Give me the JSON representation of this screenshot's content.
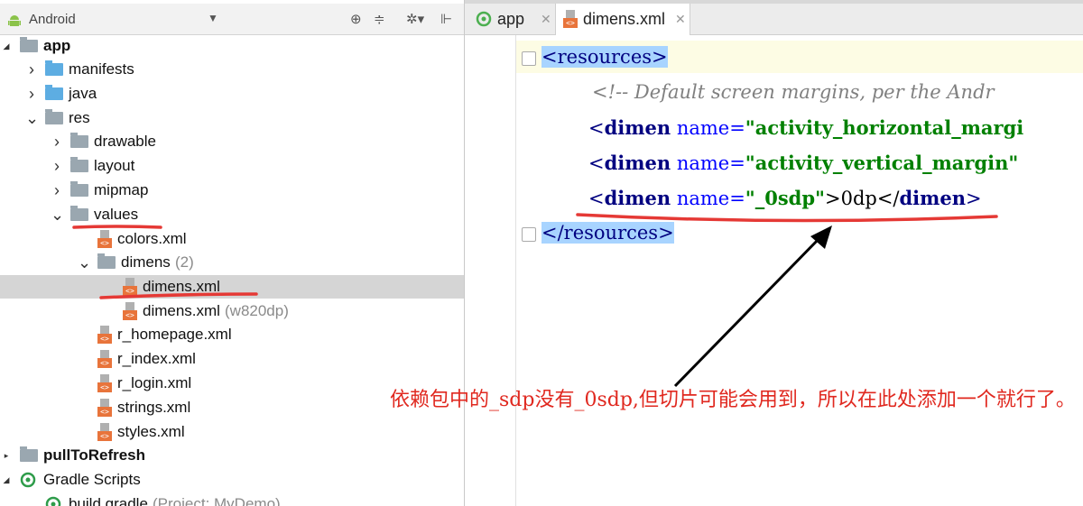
{
  "project_panel": {
    "view_label": "Android",
    "dropdown_icon": "triangle-down",
    "tools": [
      "crosshair-icon",
      "collapse-icon",
      "gear-icon",
      "pin-icon"
    ]
  },
  "tree": [
    {
      "label": "app",
      "bold": true,
      "icon": "module-folder",
      "expanded": true
    },
    {
      "label": "manifests",
      "icon": "folder-blue",
      "expanded": false
    },
    {
      "label": "java",
      "icon": "folder-blue",
      "expanded": false
    },
    {
      "label": "res",
      "icon": "res-folder",
      "expanded": true
    },
    {
      "label": "drawable",
      "icon": "folder-gray",
      "expanded": false
    },
    {
      "label": "layout",
      "icon": "folder-gray",
      "expanded": false
    },
    {
      "label": "mipmap",
      "icon": "folder-gray",
      "expanded": false
    },
    {
      "label": "values",
      "icon": "folder-gray",
      "expanded": true
    },
    {
      "label": "colors.xml",
      "icon": "xml-file"
    },
    {
      "label": "dimens",
      "qualifier": "(2)",
      "icon": "folder-gray",
      "expanded": true
    },
    {
      "label": "dimens.xml",
      "icon": "xml-file",
      "selected": true
    },
    {
      "label": "dimens.xml",
      "qualifier": "(w820dp)",
      "icon": "xml-file"
    },
    {
      "label": "r_homepage.xml",
      "icon": "xml-file"
    },
    {
      "label": "r_index.xml",
      "icon": "xml-file"
    },
    {
      "label": "r_login.xml",
      "icon": "xml-file"
    },
    {
      "label": "strings.xml",
      "icon": "xml-file"
    },
    {
      "label": "styles.xml",
      "icon": "xml-file"
    },
    {
      "label": "pullToRefresh",
      "bold": true,
      "icon": "module-folder",
      "expanded": false
    },
    {
      "label": "Gradle Scripts",
      "icon": "gradle-icon",
      "expanded": true
    },
    {
      "label": "build.gradle",
      "qualifier": "(Project: MyDemo)",
      "icon": "gradle-icon"
    }
  ],
  "editor": {
    "tabs": [
      {
        "label": "app",
        "icon": "app-module-icon"
      },
      {
        "label": "dimens.xml",
        "icon": "xml-file-icon",
        "active": true
      }
    ],
    "lines": {
      "l1_open": "<",
      "l1_name": "resources",
      "l1_close": ">",
      "l2_comment": "<!-- Default screen margins, per the Andr",
      "l3_open": "<",
      "l3_name": "dimen",
      "l3_attr": "name=",
      "l3_val": "\"activity_horizontal_margi",
      "l4_open": "<",
      "l4_name": "dimen",
      "l4_attr": "name=",
      "l4_val": "\"activity_vertical_margin\"",
      "l5_open": "<",
      "l5_name": "dimen",
      "l5_attr": "name=",
      "l5_val": "\"_0sdp\"",
      "l5_text": ">0dp</",
      "l5_name2": "dimen",
      "l5_end": ">",
      "l6_open": "</",
      "l6_name": "resources",
      "l6_close": ">"
    }
  },
  "annotation": {
    "text": "依赖包中的_sdp没有_0sdp,但切片可能会用到，所以在此处添加一个就行了。",
    "color": "#e0281f"
  },
  "colors": {
    "selection": "#d5d5d5",
    "tag": "#000080",
    "attr": "#0000ff",
    "value": "#008000",
    "comment": "#808080",
    "highlight": "#a8d4ff"
  }
}
